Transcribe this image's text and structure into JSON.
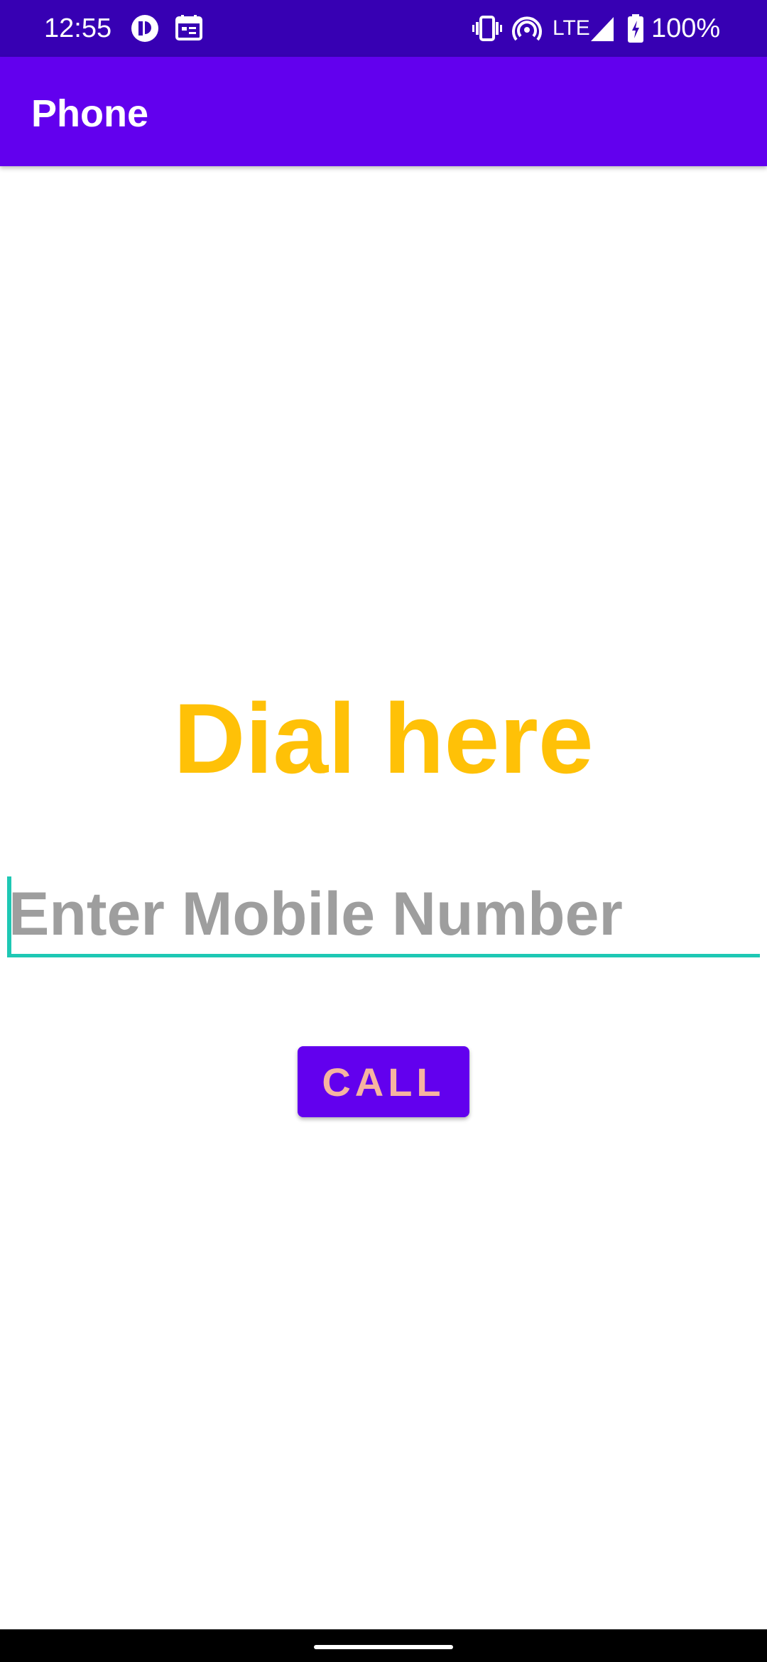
{
  "status_bar": {
    "time": "12:55",
    "network": "LTE",
    "battery": "100%",
    "icons": [
      "data-saver-icon",
      "calendar-icon",
      "vibrate-icon",
      "hotspot-icon",
      "signal-icon",
      "battery-charging-icon"
    ]
  },
  "app_bar": {
    "title": "Phone"
  },
  "main": {
    "heading": "Dial here",
    "phone_input": {
      "placeholder": "Enter Mobile Number",
      "value": ""
    },
    "call_button_label": "CALL"
  },
  "colors": {
    "status_bar": "#3700b3",
    "primary": "#6200ee",
    "heading": "#ffc107",
    "accent": "#1ec8b4",
    "placeholder": "#9e9e9e",
    "button_text": "#f6b4a0"
  }
}
